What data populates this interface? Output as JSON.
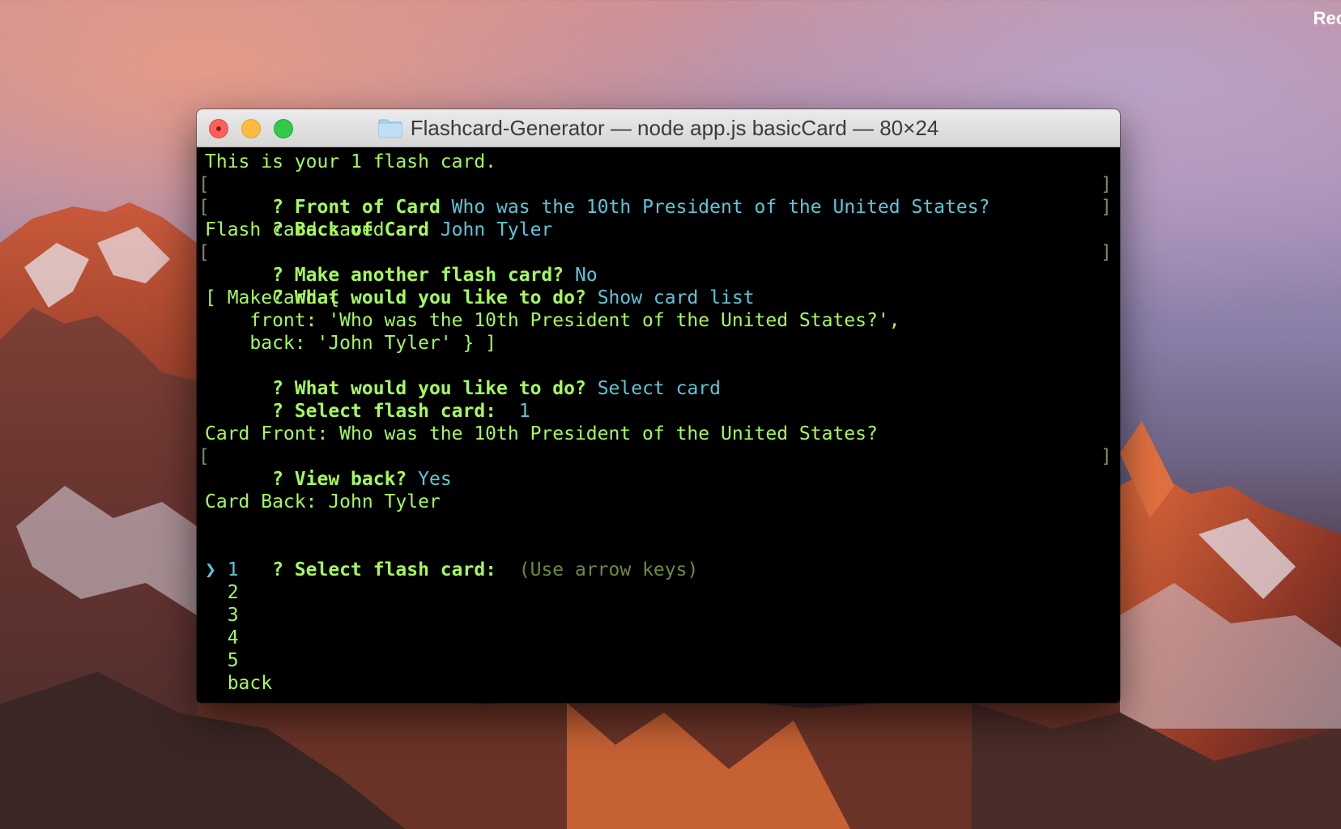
{
  "desktop": {
    "corner_label": "Rec"
  },
  "window": {
    "title": "Flashcard-Generator — node app.js basicCard — 80×24"
  },
  "terminal": {
    "line1": "This is your 1 flash card.",
    "q_front_prompt": "? Front of Card",
    "q_front_answer": "Who was the 10th President of the United States?",
    "q_back_prompt": "? Back of Card",
    "q_back_answer": "John Tyler",
    "saved": "Flash card saved",
    "q_another_prompt": "? Make another flash card?",
    "q_another_answer": "No",
    "q_todo1_prompt": "? What would you like to do?",
    "q_todo1_answer": "Show card list",
    "obj_line1": "[ MakeCard {",
    "obj_line2": "    front: 'Who was the 10th President of the United States?',",
    "obj_line3": "    back: 'John Tyler' } ]",
    "q_todo2_prompt": "? What would you like to do?",
    "q_todo2_answer": "Select card",
    "q_select1_prompt": "? Select flash card:",
    "q_select1_answer": "1",
    "card_front": "Card Front: Who was the 10th President of the United States?",
    "q_viewback_prompt": "? View back?",
    "q_viewback_answer": "Yes",
    "card_back": "Card Back: John Tyler",
    "q_select2_prompt": "? Select flash card:",
    "q_select2_hint": "(Use arrow keys)",
    "pointer": "❯",
    "options": [
      "1",
      "2",
      "3",
      "4",
      "5",
      "back"
    ]
  },
  "colors": {
    "terminal_green": "#a6f95a",
    "terminal_cyan": "#5fc5d8",
    "terminal_bg": "#000000"
  }
}
